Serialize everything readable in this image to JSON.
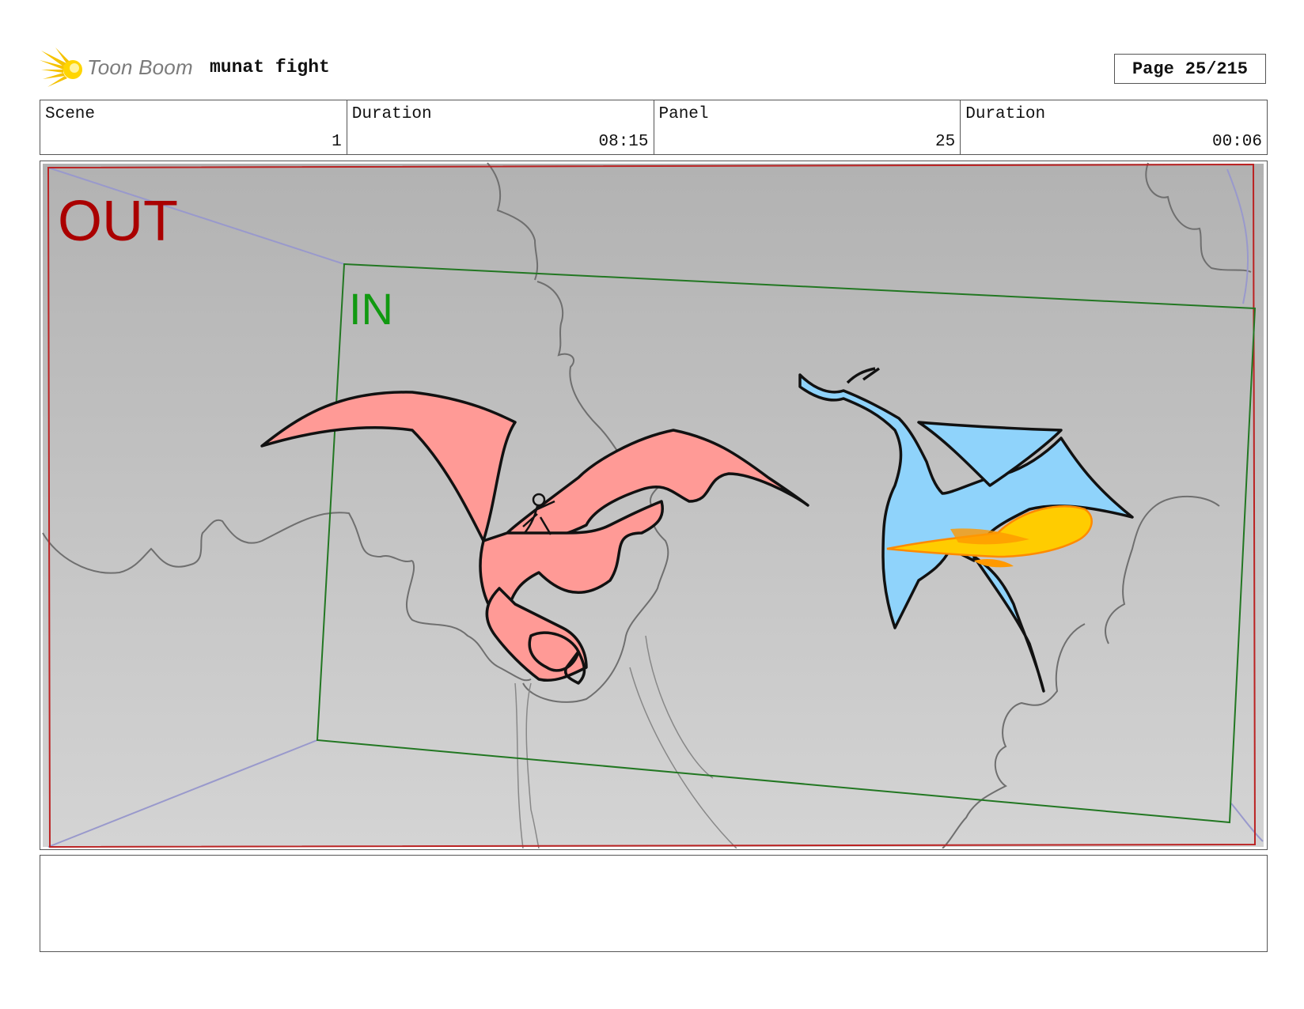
{
  "header": {
    "brand": "Toon Boom",
    "project_title": "munat fight",
    "page_label": "Page",
    "page_value": "25/215"
  },
  "info": {
    "scene_label": "Scene",
    "scene_value": "1",
    "scene_duration_label": "Duration",
    "scene_duration_value": "08:15",
    "panel_label": "Panel",
    "panel_value": "25",
    "panel_duration_label": "Duration",
    "panel_duration_value": "00:06"
  },
  "frame": {
    "out_label": "OUT",
    "in_label": "IN",
    "out_color": "#aa0000",
    "in_color": "#119911",
    "red_dragon_color": "#ff9a96",
    "blue_dragon_color": "#8fd3fb",
    "fire_color": "#ffcc00"
  },
  "notes": {
    "text": ""
  }
}
